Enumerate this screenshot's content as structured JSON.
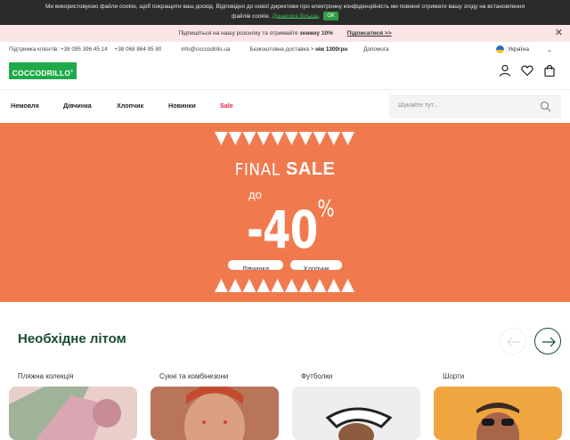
{
  "cookie": {
    "text_line1": "Ми використовуємо файли cookie, щоб покращити ваш досвід. Відповідно до нової директиви про електронну конфіденційність ми повинні отримати вашу згоду на встановлення",
    "text_line2": "файлів cookie.",
    "learn_more": "Дізнатися більше",
    "dot": ".",
    "ok": "OK"
  },
  "promo": {
    "text": "Підпишіться на нашу розсилку та отримайте",
    "highlight": "знижку 10%",
    "subscribe": "Підписатися >>",
    "close": "✕"
  },
  "contacts": {
    "support_label": "Підтримка клієнтів:",
    "phone1": "+38 095 396 45 14",
    "phone2": "+38 068 864 95 80",
    "email": "info@coccodrillo.ua",
    "delivery_text": "Безкоштовна доставка >",
    "delivery_highlight": "ніж 1300грн",
    "help": "Допомога"
  },
  "language": {
    "selected": "Україна",
    "chevron": "⌄"
  },
  "logo": {
    "text": "COCCODRILLO"
  },
  "nav": {
    "items": [
      "Немовля",
      "Дівчинка",
      "Хлопчик",
      "Новинки",
      "Sale"
    ]
  },
  "search": {
    "placeholder": "Шукайте тут..."
  },
  "hero": {
    "final": "FINAL",
    "sale": "SALE",
    "up_to": "до",
    "discount": "-40",
    "percent": "%",
    "buttons": [
      "Дівчинка",
      "Хлопчик"
    ]
  },
  "section": {
    "title": "Необхідне літом",
    "categories": [
      "Пляжна колекція",
      "Сукні та комбінезони",
      "Футболки",
      "Шорти"
    ]
  },
  "colors": {
    "brand_green": "#1faa4a",
    "hero_orange": "#f07a4e",
    "sale_red": "#e0294a",
    "title_green": "#1a4d2e"
  }
}
